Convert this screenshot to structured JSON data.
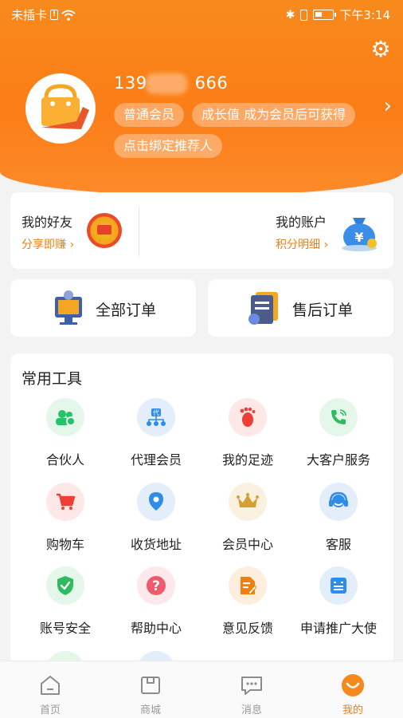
{
  "status": {
    "carrier": "未插卡",
    "time": "下午3:14"
  },
  "profile": {
    "phone_prefix": "139",
    "phone_suffix": "666",
    "tags": [
      "普通会员",
      "成长值 成为会员后可获得",
      "点击绑定推荐人"
    ]
  },
  "friends": {
    "title": "我的好友",
    "sub": "分享即赚",
    "account_title": "我的账户",
    "account_sub": "积分明细"
  },
  "orders": {
    "all": "全部订单",
    "after_sale": "售后订单"
  },
  "tools": {
    "title": "常用工具",
    "items": [
      {
        "label": "合伙人",
        "icon": "partner-icon",
        "color": "#26c26a"
      },
      {
        "label": "代理会员",
        "icon": "agent-icon",
        "color": "#2e8de8"
      },
      {
        "label": "我的足迹",
        "icon": "footprint-icon",
        "color": "#ef3e36"
      },
      {
        "label": "大客户服务",
        "icon": "phone-icon",
        "color": "#2dbb5e"
      },
      {
        "label": "购物车",
        "icon": "cart-icon",
        "color": "#ef3e36"
      },
      {
        "label": "收货地址",
        "icon": "location-icon",
        "color": "#2e8de8"
      },
      {
        "label": "会员中心",
        "icon": "crown-icon",
        "color": "#d4a033"
      },
      {
        "label": "客服",
        "icon": "headset-icon",
        "color": "#2e8de8"
      },
      {
        "label": "账号安全",
        "icon": "shield-icon",
        "color": "#2dbb5e"
      },
      {
        "label": "帮助中心",
        "icon": "question-icon",
        "color": "#ef5a6c"
      },
      {
        "label": "意见反馈",
        "icon": "feedback-icon",
        "color": "#f07f12"
      },
      {
        "label": "申请推广大使",
        "icon": "ambassador-icon",
        "color": "#2e8de8"
      }
    ]
  },
  "tabs": [
    {
      "label": "首页"
    },
    {
      "label": "商城"
    },
    {
      "label": "消息"
    },
    {
      "label": "我的"
    }
  ],
  "colors": {
    "accent": "#f07f12",
    "header": "#fb7d17"
  }
}
